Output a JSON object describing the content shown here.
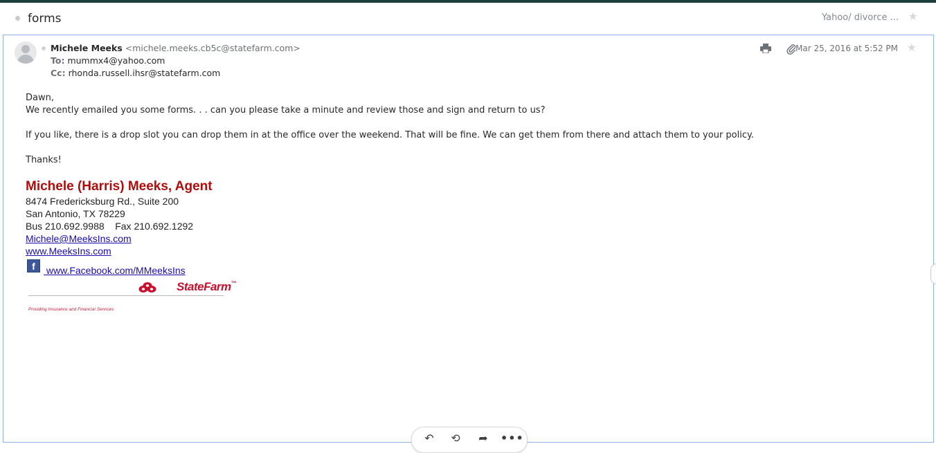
{
  "subject": {
    "title": "forms",
    "folder": "Yahoo/ divorce ..."
  },
  "message": {
    "from_name": "Michele Meeks",
    "from_email": "<michele.meeks.cb5c@statefarm.com>",
    "to_label": "To:",
    "to_value": "mummx4@yahoo.com",
    "cc_label": "Cc:",
    "cc_value": "rhonda.russell.ihsr@statefarm.com",
    "date": "Mar 25, 2016 at 5:52 PM"
  },
  "body": {
    "greeting": "Dawn,",
    "line1": "We recently emailed you some forms. . . can you please take a minute and review those and sign and return to us?",
    "line2": "If you like, there is a drop slot you can drop them in at the office over the weekend. That will be fine. We can get them from there and attach them to your policy.",
    "closing": "Thanks!"
  },
  "signature": {
    "name": "Michele (Harris) Meeks, Agent",
    "address1": "8474 Fredericksburg Rd., Suite 200",
    "address2": "San Antonio, TX 78229",
    "phones": "Bus 210.692.9988    Fax 210.692.1292",
    "email_link": "Michele@MeeksIns.com",
    "web_link": "www.MeeksIns.com",
    "facebook_link": " www.Facebook.com/MMeeksIns"
  },
  "logo": {
    "brand": "StateFarm",
    "tm": "™",
    "tagline": "Providing Insurance and Financial Services",
    "color": "#c8102e"
  },
  "colors": {
    "accent_bar": "#1b3f3a",
    "card_border": "#8fb3e8",
    "signature_red": "#b00c0c",
    "link": "#1a0dab"
  },
  "icons": {
    "print": "print-icon",
    "attachment": "paperclip-icon",
    "star": "star-icon",
    "reply": "reply-icon",
    "reply_all": "reply-all-icon",
    "forward": "forward-icon",
    "more": "more-icon",
    "facebook": "facebook-icon"
  }
}
